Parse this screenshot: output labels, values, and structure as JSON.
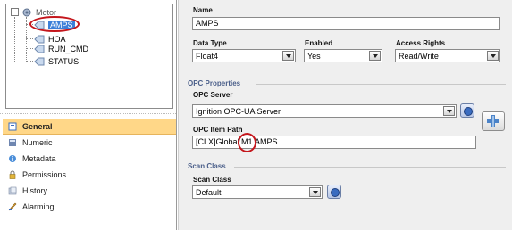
{
  "tree": {
    "root": "Motor",
    "children": [
      "AMPS",
      "HOA",
      "RUN_CMD",
      "STATUS"
    ],
    "selected": "AMPS"
  },
  "nav": [
    {
      "label": "General",
      "icon": "general-icon",
      "active": true
    },
    {
      "label": "Numeric",
      "icon": "numeric-icon",
      "active": false
    },
    {
      "label": "Metadata",
      "icon": "metadata-icon",
      "active": false
    },
    {
      "label": "Permissions",
      "icon": "permissions-icon",
      "active": false
    },
    {
      "label": "History",
      "icon": "history-icon",
      "active": false
    },
    {
      "label": "Alarming",
      "icon": "alarming-icon",
      "active": false
    }
  ],
  "general": {
    "name_label": "Name",
    "name_value": "AMPS",
    "data_type_label": "Data Type",
    "data_type_value": "Float4",
    "enabled_label": "Enabled",
    "enabled_value": "Yes",
    "access_label": "Access Rights",
    "access_value": "Read/Write"
  },
  "opc": {
    "section": "OPC Properties",
    "server_label": "OPC Server",
    "server_value": "Ignition OPC-UA Server",
    "item_path_label": "OPC Item Path",
    "item_path_value": "[CLX]Global.M1.AMPS"
  },
  "scan": {
    "section": "Scan Class",
    "label": "Scan Class",
    "value": "Default"
  },
  "colors": {
    "highlight": "#c4161c",
    "active_nav": "#ffd788",
    "section_title": "#4b5f8a"
  }
}
